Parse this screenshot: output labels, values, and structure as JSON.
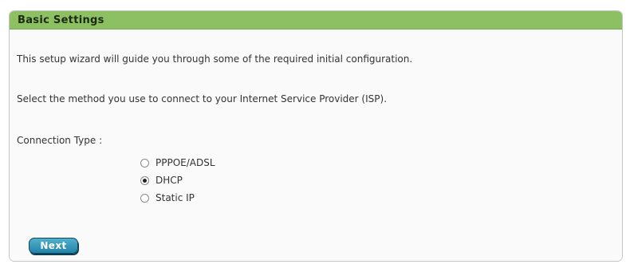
{
  "panel": {
    "title": "Basic Settings"
  },
  "intro_text": "This setup wizard will guide you through some of the required initial configuration.",
  "method_text": "Select the method you use to connect to your Internet Service Provider (ISP).",
  "connection": {
    "label": "Connection Type :",
    "options": [
      {
        "label": "PPPOE/ADSL",
        "checked": false
      },
      {
        "label": "DHCP",
        "checked": true
      },
      {
        "label": "Static IP",
        "checked": false
      }
    ],
    "selected": "DHCP"
  },
  "buttons": {
    "next_label": "Next"
  },
  "colors": {
    "header_green": "#8cc063",
    "button_blue": "#2283a8"
  }
}
